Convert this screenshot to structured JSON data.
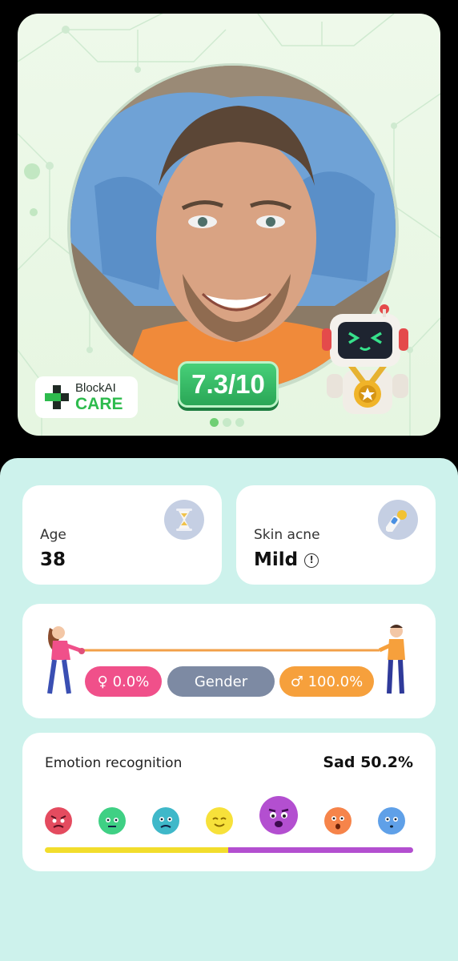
{
  "hero": {
    "brand_line1": "BlockAI",
    "brand_line2": "CARE",
    "score": "7.3/10",
    "carousel_active_index": 0,
    "carousel_count": 3
  },
  "age": {
    "label": "Age",
    "value": "38",
    "icon": "hourglass-icon"
  },
  "skin": {
    "label": "Skin acne",
    "value": "Mild",
    "icon": "sunscreen-icon",
    "info_glyph": "!"
  },
  "gender": {
    "female_label": "♀ 0.0%",
    "center_label": "Gender",
    "male_label": "♂ 100.0%",
    "female_color": "#f0508a",
    "center_color": "#7d8aa3",
    "male_color": "#f6a03c",
    "female_value": 0.0,
    "male_value": 100.0
  },
  "emotion": {
    "title": "Emotion recognition",
    "result": "Sad 50.2%",
    "selected": "sad",
    "faces": [
      "angry",
      "disgust",
      "fear",
      "happy",
      "sad",
      "surprise",
      "neutral"
    ],
    "bar_value": 50.2,
    "bar_colors": [
      "#f2dd2c",
      "#b34fd0"
    ]
  }
}
